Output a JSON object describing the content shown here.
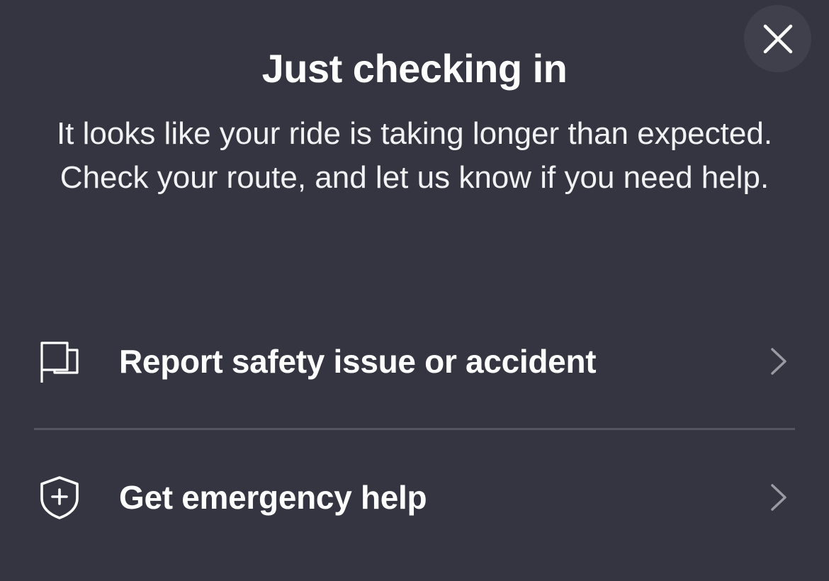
{
  "dialog": {
    "title": "Just checking in",
    "message": "It looks like your ride is taking longer than expected. Check your route, and let us know if you need help.",
    "close_icon": "close-icon"
  },
  "options": [
    {
      "label": "Report safety issue or accident",
      "icon": "flag-icon",
      "chevron": "chevron-right-icon"
    },
    {
      "label": "Get emergency help",
      "icon": "shield-plus-icon",
      "chevron": "chevron-right-icon"
    }
  ],
  "colors": {
    "background": "#353541",
    "close_button_bg": "#40404c",
    "divider": "#55555f",
    "text": "#ffffff",
    "chevron": "#9a9aa3"
  }
}
